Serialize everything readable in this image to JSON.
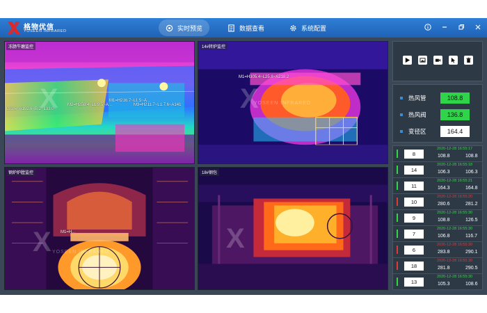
{
  "app": {
    "brand_cn": "格物优信",
    "brand_en": "YOSEEN INFRARED"
  },
  "nav": [
    {
      "label": "实时预览",
      "icon": "camera-lens-icon",
      "active": true
    },
    {
      "label": "数据查看",
      "icon": "document-icon",
      "active": false
    },
    {
      "label": "系统配置",
      "icon": "gear-icon",
      "active": false
    }
  ],
  "window_controls": [
    "info-icon",
    "minimize-icon",
    "restore-icon",
    "close-icon"
  ],
  "cameras": [
    {
      "title": "冻肠牛磨监控",
      "readouts": [
        "M2=H258.4~L1.9.5~A...",
        "M1=H216.7~L1.5~A...",
        "M3=H211.7~L1.7.6~A141",
        "L33.6~A192.6~B.2~L33.0~"
      ]
    },
    {
      "title": "14#转炉监控",
      "readouts": [
        "M1=H305.4~L25.8~A218.2"
      ]
    },
    {
      "title": "钢炉炉膛监控",
      "readouts": [
        "M1=H..."
      ]
    },
    {
      "title": "18#钢包",
      "readouts": []
    }
  ],
  "watermark": "YOSEEN INFRARED",
  "tools": [
    "play-icon",
    "image-icon",
    "video-icon",
    "cursor-icon",
    "trash-icon"
  ],
  "zones": [
    {
      "label": "热风管",
      "value": "108.8",
      "color": "#2fd44a"
    },
    {
      "label": "热风阀",
      "value": "136.8",
      "color": "#2fd44a"
    },
    {
      "label": "变径区",
      "value": "164.4",
      "color": "#ffffff"
    }
  ],
  "alarms": [
    {
      "id": "8",
      "time": "2020-12-28 16:55:17",
      "a": "108.8",
      "b": "108.8",
      "status": "normal"
    },
    {
      "id": "14",
      "time": "2020-12-28 16:55:18",
      "a": "106.3",
      "b": "106.3",
      "status": "normal"
    },
    {
      "id": "11",
      "time": "2020-12-28 16:55:21",
      "a": "164.3",
      "b": "164.8",
      "status": "normal"
    },
    {
      "id": "10",
      "time": "2020-12-28 16:55:20",
      "a": "280.6",
      "b": "281.2",
      "status": "alarm"
    },
    {
      "id": "9",
      "time": "2020-12-28 16:55:30",
      "a": "108.8",
      "b": "126.5",
      "status": "normal"
    },
    {
      "id": "7",
      "time": "2020-12-28 16:55:30",
      "a": "106.8",
      "b": "116.7",
      "status": "normal"
    },
    {
      "id": "6",
      "time": "2020-12-28 16:55:30",
      "a": "283.8",
      "b": "290.1",
      "status": "alarm"
    },
    {
      "id": "18",
      "time": "2020-12-28 16:55:30",
      "a": "281.8",
      "b": "290.5",
      "status": "alarm"
    },
    {
      "id": "13",
      "time": "2020-12-28 16:55:30",
      "a": "105.3",
      "b": "108.6",
      "status": "normal"
    }
  ],
  "colors": {
    "normal": "#36d64a",
    "alarm": "#e03a3a",
    "accent": "#2f7fd6"
  }
}
